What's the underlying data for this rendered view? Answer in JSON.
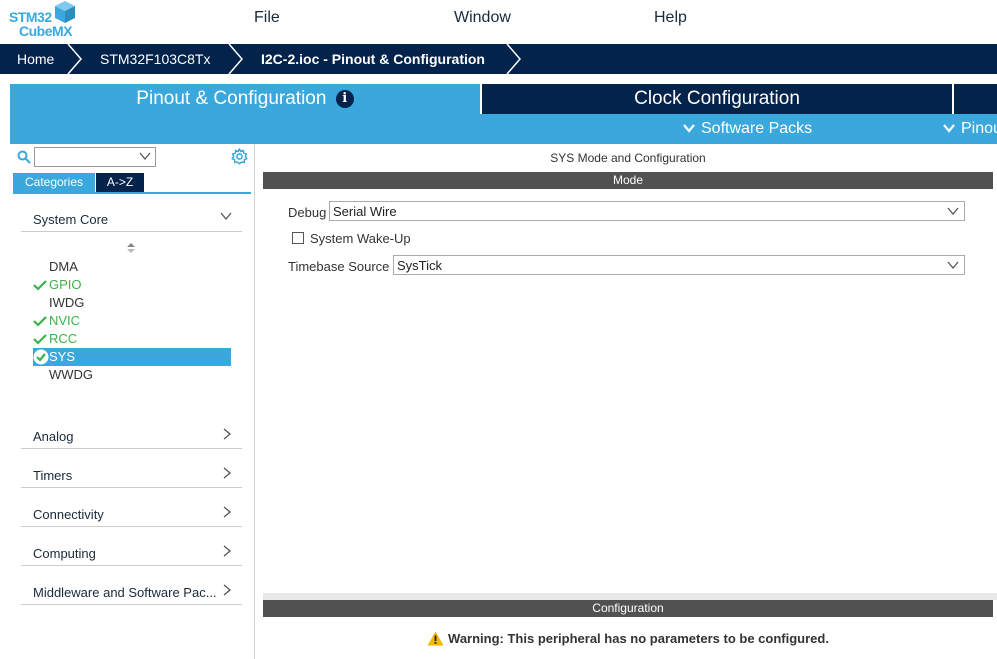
{
  "app": {
    "logo_line1": "STM32",
    "logo_line2": "CubeMX",
    "accent_color": "#3aa8dc",
    "navy_color": "#03234b"
  },
  "menu": {
    "file": "File",
    "window": "Window",
    "help": "Help"
  },
  "breadcrumb": {
    "home": "Home",
    "mcu": "STM32F103C8Tx",
    "project": "I2C-2.ioc - Pinout & Configuration"
  },
  "tabs": {
    "pinout": "Pinout & Configuration",
    "clock": "Clock Configuration"
  },
  "subbar": {
    "software_packs": "Software Packs",
    "pinout": "Pinout"
  },
  "left": {
    "search_value": "",
    "tab_categories": "Categories",
    "tab_az": "A->Z",
    "system_core": "System Core",
    "peripherals": [
      {
        "name": "DMA",
        "checked": false
      },
      {
        "name": "GPIO",
        "checked": true
      },
      {
        "name": "IWDG",
        "checked": false
      },
      {
        "name": "NVIC",
        "checked": true
      },
      {
        "name": "RCC",
        "checked": true
      },
      {
        "name": "SYS",
        "checked": true,
        "selected": true
      },
      {
        "name": "WWDG",
        "checked": false
      }
    ],
    "categories": [
      {
        "label": "Analog"
      },
      {
        "label": "Timers"
      },
      {
        "label": "Connectivity"
      },
      {
        "label": "Computing"
      },
      {
        "label": "Middleware and Software Pac..."
      }
    ]
  },
  "right": {
    "title": "SYS Mode and Configuration",
    "mode_header": "Mode",
    "debug_label": "Debug",
    "debug_value": "Serial Wire",
    "wakeup_label": "System Wake-Up",
    "wakeup_checked": false,
    "timebase_label": "Timebase Source",
    "timebase_value": "SysTick",
    "config_header": "Configuration",
    "warning": "Warning: This peripheral has no parameters to be configured."
  }
}
